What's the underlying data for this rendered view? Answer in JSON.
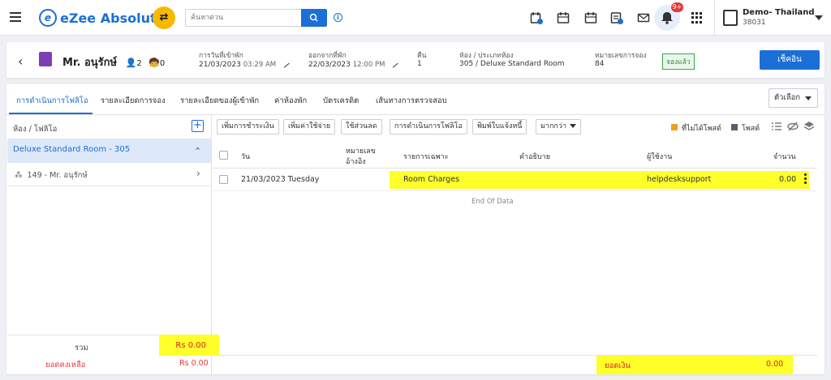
{
  "app": {
    "logo_text": "eZee Absolute",
    "logo_mark": "e",
    "brand_color": "#1b6fd6"
  },
  "topbar": {
    "search_placeholder": "ค้นหาด่วน",
    "notification_count": "9+",
    "hotel_name": "Demo- Thailand",
    "hotel_code": "38031",
    "icons": [
      "calendar-plus-icon",
      "calendar-check-icon",
      "calendar-icon",
      "calendar-list-icon",
      "mail-icon",
      "bell-icon",
      "apps-grid-icon",
      "hotel-building-icon"
    ]
  },
  "header": {
    "back": "‹",
    "guest_name": "Mr. อนุรักษ์",
    "adults": "2",
    "children": "0",
    "arrival_label": "การวันที่เข้าพัก",
    "arrival_date": "21/03/2023",
    "arrival_time": "03:29 AM",
    "departure_label": "ออกจากที่พัก",
    "departure_date": "22/03/2023",
    "departure_time": "12:00 PM",
    "nights_label": "คืน",
    "nights_value": "1",
    "room_label": "ห้อง / ประเภทห้อง",
    "room_value": "305 / Deluxe Standard Room",
    "res_no_label": "หมายเลขการจอง",
    "res_no_value": "84",
    "status": "จองแล้ว",
    "checkin_button": "เช็คอิน"
  },
  "tabs": [
    {
      "label": "การดำเนินการโฟลิโอ",
      "active": true
    },
    {
      "label": "รายละเอียดการจอง"
    },
    {
      "label": "รายละเอียดของผู้เข้าพัก"
    },
    {
      "label": "ค่าห้องพัก"
    },
    {
      "label": "บัตรเครดิต"
    },
    {
      "label": "เส้นทางการตรวจสอบ"
    }
  ],
  "options_button": "ตัวเลือก",
  "folio": {
    "header": "ห้อง / โฟลิโอ",
    "add": "+",
    "room_row": "Deluxe Standard Room - 305",
    "guest_row": "149 - Mr. อนุรักษ์",
    "total_label": "รวม",
    "total_value": "Rs 0.00",
    "balance_label": "ยอดคงเหลือ",
    "balance_value": "Rs 0.00"
  },
  "actions": {
    "add_payment": "เพิ่มการชำระเงิน",
    "add_charge": "เพิ่มค่าใช้จ่าย",
    "apply_discount": "ใช้ส่วนลด",
    "folio_operations": "การดำเนินการโฟลิโอ",
    "print_invoice": "พิมพ์ใบแจ้งหนี้",
    "more": "มากกว่า"
  },
  "legend": {
    "unposted": "ที่ไม่ได้โพสต์",
    "unposted_color": "#f0a020",
    "posted": "โพสต์",
    "posted_color": "#556070"
  },
  "table": {
    "headers": {
      "date": "วัน",
      "ref_line1": "หมายเลข",
      "ref_line2": "อ้างอิง",
      "particulars": "รายการเฉพาะ",
      "description": "คำอธิบาย",
      "user": "ผู้ใช้งาน",
      "amount": "จำนวน"
    },
    "rows": [
      {
        "date": "21/03/2023 Tuesday",
        "ref": "",
        "particulars": "Room Charges",
        "description": "",
        "user": "helpdesksupport",
        "amount": "0.00"
      }
    ],
    "end_text": "End Of Data"
  },
  "footer": {
    "amount_label": "ยอดเงิน",
    "amount_value": "0.00"
  },
  "highlight_color": "#ffff2a"
}
